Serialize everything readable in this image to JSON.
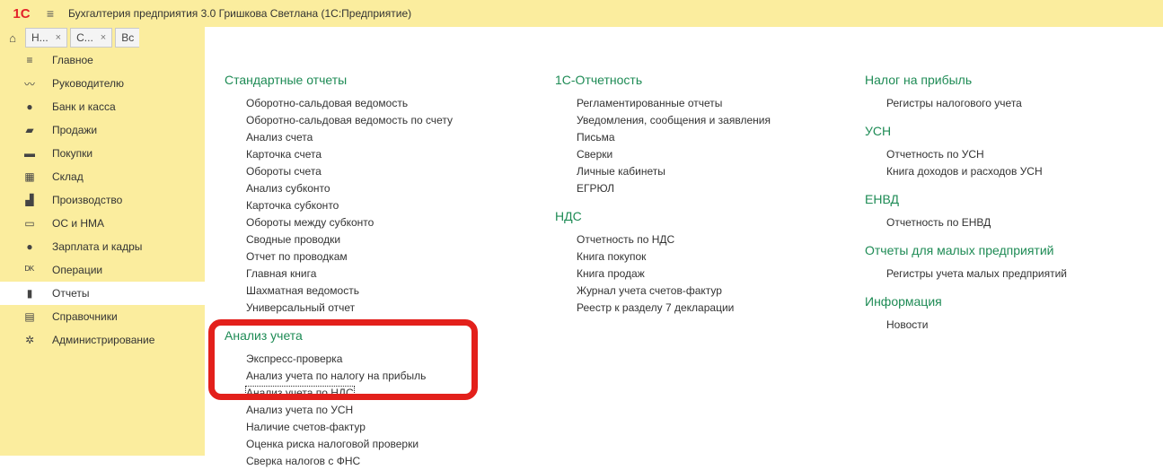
{
  "titlebar": {
    "logo": "1С",
    "menu_icon": "≡",
    "title": "Бухгалтерия предприятия 3.0 Гришкова Светлана  (1С:Предприятие)"
  },
  "tabs": [
    {
      "label": "Н..."
    },
    {
      "label": "С..."
    },
    {
      "label": "Вс"
    }
  ],
  "sidebar": {
    "items": [
      {
        "label": "Главное",
        "icon": "≡"
      },
      {
        "label": "Руководителю",
        "icon": "〰"
      },
      {
        "label": "Банк и касса",
        "icon": "●"
      },
      {
        "label": "Продажи",
        "icon": "▰"
      },
      {
        "label": "Покупки",
        "icon": "▬"
      },
      {
        "label": "Склад",
        "icon": "▦"
      },
      {
        "label": "Производство",
        "icon": "▟"
      },
      {
        "label": "ОС и НМА",
        "icon": "▭"
      },
      {
        "label": "Зарплата и кадры",
        "icon": "●"
      },
      {
        "label": "Операции",
        "icon": "ᴰᴷ"
      },
      {
        "label": "Отчеты",
        "icon": "▮"
      },
      {
        "label": "Справочники",
        "icon": "▤"
      },
      {
        "label": "Администрирование",
        "icon": "✲"
      }
    ],
    "active_index": 10
  },
  "columns": {
    "col1": [
      {
        "title": "Стандартные отчеты",
        "links": [
          "Оборотно-сальдовая ведомость",
          "Оборотно-сальдовая ведомость по счету",
          "Анализ счета",
          "Карточка счета",
          "Обороты счета",
          "Анализ субконто",
          "Карточка субконто",
          "Обороты между субконто",
          "Сводные проводки",
          "Отчет по проводкам",
          "Главная книга",
          "Шахматная ведомость",
          "Универсальный отчет"
        ]
      },
      {
        "title": "Анализ учета",
        "links": [
          "Экспресс-проверка",
          "Анализ учета по налогу на прибыль",
          "Анализ учета по НДС",
          "Анализ учета по УСН",
          "Наличие счетов-фактур",
          "Оценка риска налоговой проверки",
          "Сверка налогов с ФНС"
        ]
      }
    ],
    "col2": [
      {
        "title": "1С-Отчетность",
        "links": [
          "Регламентированные отчеты",
          "Уведомления, сообщения и заявления",
          "Письма",
          "Сверки",
          "Личные кабинеты",
          "ЕГРЮЛ"
        ]
      },
      {
        "title": "НДС",
        "links": [
          "Отчетность по НДС",
          "Книга покупок",
          "Книга продаж",
          "Журнал учета счетов-фактур",
          "Реестр к разделу 7 декларации"
        ]
      }
    ],
    "col3": [
      {
        "title": "Налог на прибыль",
        "links": [
          "Регистры налогового учета"
        ]
      },
      {
        "title": "УСН",
        "links": [
          "Отчетность по УСН",
          "Книга доходов и расходов УСН"
        ]
      },
      {
        "title": "ЕНВД",
        "links": [
          "Отчетность по ЕНВД"
        ]
      },
      {
        "title": "Отчеты для малых предприятий",
        "links": [
          "Регистры учета малых предприятий"
        ]
      },
      {
        "title": "Информация",
        "links": [
          "Новости"
        ]
      }
    ]
  },
  "colors": {
    "panel": "#fbed9e",
    "section_title": "#1e8b55",
    "highlight": "#e3201b"
  }
}
